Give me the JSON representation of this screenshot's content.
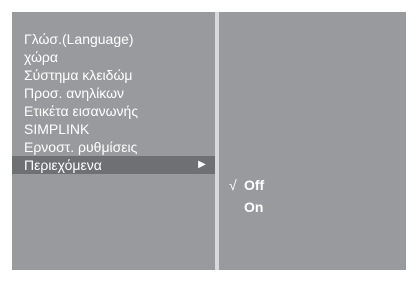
{
  "menu": {
    "items": [
      {
        "label": "Γλώσ.(Language)"
      },
      {
        "label": "χώρα"
      },
      {
        "label": "Σύστημα κλειδώμ"
      },
      {
        "label": "Προσ. ανηλίκων"
      },
      {
        "label": "Ετικέτα εισανωνής"
      },
      {
        "label": "SIMPLINK"
      },
      {
        "label": "Ερνοστ. ρυθμίσεις"
      },
      {
        "label": "Περιεχόμενα",
        "selected": true,
        "arrow_icon": "right-triangle-icon"
      }
    ]
  },
  "submenu": {
    "options": [
      {
        "label": "Off",
        "checked": true,
        "check_icon": "checkmark-icon",
        "check_glyph": "√"
      },
      {
        "label": "On",
        "checked": false
      }
    ]
  },
  "colors": {
    "panel": "#999a9d",
    "divider": "#d9d9db",
    "highlight": "#6f7074",
    "text": "#ffffff"
  }
}
